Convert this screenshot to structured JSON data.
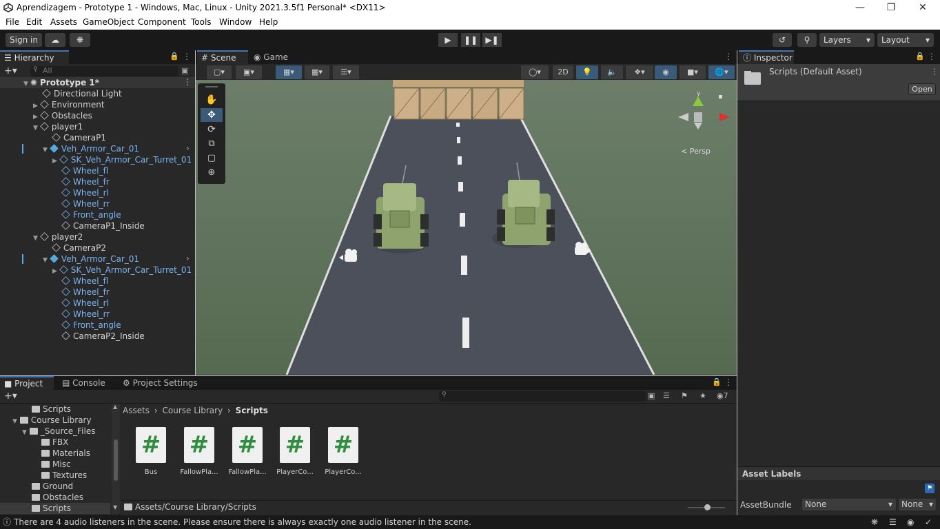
{
  "window": {
    "title": "Aprendizagem - Prototype 1 - Windows, Mac, Linux - Unity 2021.3.5f1 Personal* <DX11>"
  },
  "menu": [
    "File",
    "Edit",
    "Assets",
    "GameObject",
    "Component",
    "Tools",
    "Window",
    "Help"
  ],
  "toolbar": {
    "sign_in": "Sign in",
    "layers": "Layers",
    "layout": "Layout"
  },
  "hierarchy": {
    "tab": "Hierarchy",
    "search_placeholder": "All",
    "items": [
      {
        "label": "Prototype 1*",
        "type": "scene"
      },
      {
        "label": "Directional Light"
      },
      {
        "label": "Environment"
      },
      {
        "label": "Obstacles"
      },
      {
        "label": "player1"
      },
      {
        "label": "CameraP1"
      },
      {
        "label": "Veh_Armor_Car_01",
        "prefab": true
      },
      {
        "label": "SK_Veh_Armor_Car_Turret_01",
        "prefab": true
      },
      {
        "label": "Wheel_fl",
        "prefab": true
      },
      {
        "label": "Wheel_fr",
        "prefab": true
      },
      {
        "label": "Wheel_rl",
        "prefab": true
      },
      {
        "label": "Wheel_rr",
        "prefab": true
      },
      {
        "label": "Front_angle",
        "prefab": true
      },
      {
        "label": "CameraP1_Inside"
      },
      {
        "label": "player2"
      },
      {
        "label": "CameraP2"
      },
      {
        "label": "Veh_Armor_Car_01",
        "prefab": true
      },
      {
        "label": "SK_Veh_Armor_Car_Turret_01",
        "prefab": true
      },
      {
        "label": "Wheel_fl",
        "prefab": true
      },
      {
        "label": "Wheel_fr",
        "prefab": true
      },
      {
        "label": "Wheel_rl",
        "prefab": true
      },
      {
        "label": "Wheel_rr",
        "prefab": true
      },
      {
        "label": "Front_angle",
        "prefab": true
      },
      {
        "label": "CameraP2_Inside"
      }
    ]
  },
  "scene_tabs": {
    "scene": "Scene",
    "game": "Game"
  },
  "scene_toolbar": {
    "mode_2d": "2D"
  },
  "scene_view": {
    "projection": "< Persp",
    "gizmo_y": "y"
  },
  "inspector": {
    "tab": "Inspector",
    "asset_title": "Scripts (Default Asset)",
    "open_button": "Open",
    "asset_labels": "Asset Labels",
    "asset_bundle": "AssetBundle",
    "bundle_value": "None",
    "bundle_variant": "None"
  },
  "project": {
    "tabs": [
      "Project",
      "Console",
      "Project Settings"
    ],
    "tree": [
      {
        "label": "Scripts"
      },
      {
        "label": "Course Library"
      },
      {
        "label": "_Source_Files"
      },
      {
        "label": "FBX"
      },
      {
        "label": "Materials"
      },
      {
        "label": "Misc"
      },
      {
        "label": "Textures"
      },
      {
        "label": "Ground"
      },
      {
        "label": "Obstacles"
      },
      {
        "label": "Scripts"
      }
    ],
    "breadcrumb": [
      "Assets",
      "Course Library",
      "Scripts"
    ],
    "assets": [
      "Bus",
      "FallowPla...",
      "FallowPla...",
      "PlayerCo...",
      "PlayerCo..."
    ],
    "path": "Assets/Course Library/Scripts",
    "hidden_count": "7"
  },
  "status": {
    "message": "There are 4 audio listeners in the scene. Please ensure there is always exactly one audio listener in the scene."
  },
  "colors": {
    "accent": "#3a79bb",
    "prefab_text": "#7cb4f3",
    "script_hash": "#2f8e3b"
  }
}
